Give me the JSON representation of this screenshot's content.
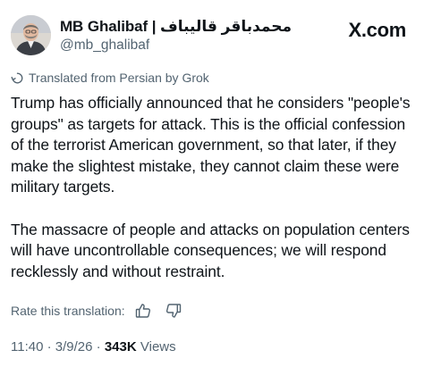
{
  "author": {
    "display_name": "MB Ghalibaf | محمدباقر قالیباف",
    "handle": "@mb_ghalibaf",
    "avatar_icon": "person-portrait-icon"
  },
  "brand": {
    "label": "X.com"
  },
  "translation": {
    "notice": "Translated from Persian by Grok",
    "icon": "translate-icon"
  },
  "post": {
    "paragraphs": [
      "Trump has officially announced that he considers \"people's groups\" as targets for attack. This is the official confession of the terrorist American government, so that later, if they make the slightest mistake, they cannot claim these were military targets.",
      "The massacre of people and attacks on population centers will have uncontrollable consequences; we will respond recklessly and without restraint."
    ]
  },
  "rating": {
    "prompt": "Rate this translation:",
    "like_icon": "thumbs-up-icon",
    "dislike_icon": "thumbs-down-icon"
  },
  "meta": {
    "time": "11:40",
    "separator": "·",
    "date": "3/9/26",
    "views_count": "343K",
    "views_label": "Views"
  },
  "colors": {
    "text_primary": "#0f1419",
    "text_secondary": "#536471",
    "background": "#ffffff"
  }
}
